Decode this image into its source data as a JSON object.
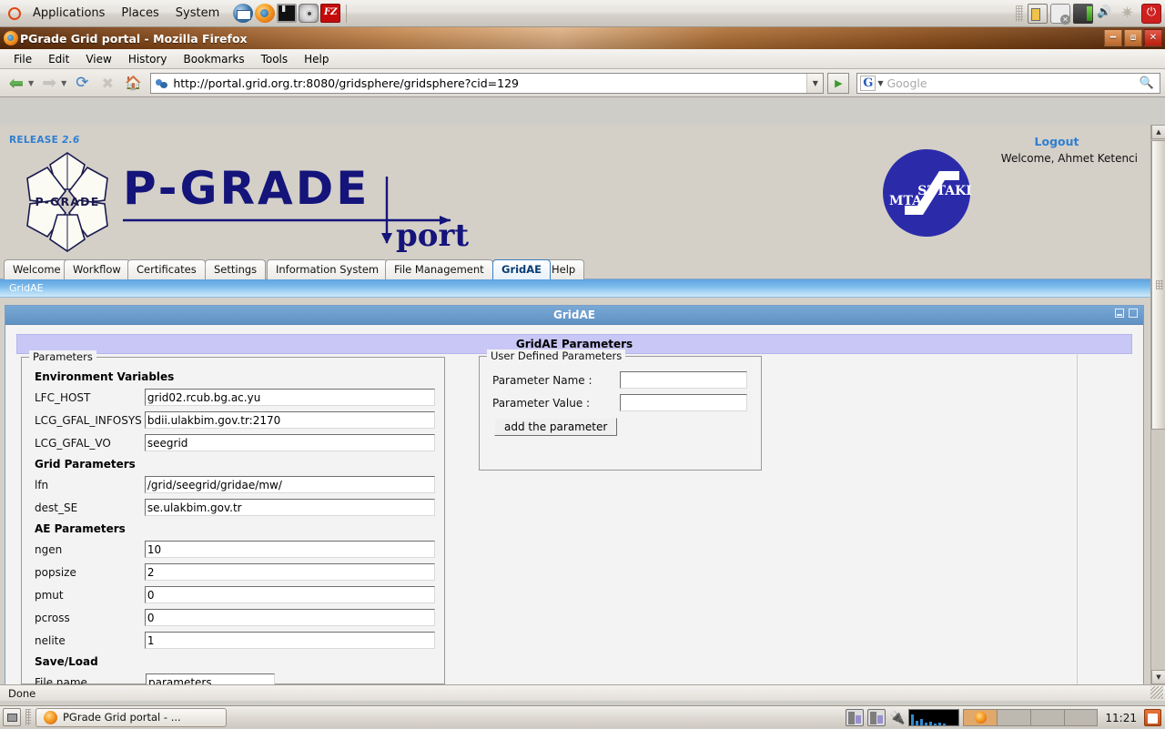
{
  "desktop": {
    "top_panel": {
      "menus": [
        "Applications",
        "Places",
        "System"
      ],
      "launchers": [
        "thunderbird-icon",
        "firefox-icon",
        "terminal-icon",
        "disc-burner-icon",
        "filezilla-icon"
      ],
      "tray": [
        "battery-icon",
        "message-icon",
        "network-icon",
        "volume-icon",
        "gear-icon",
        "power-icon"
      ]
    },
    "bottom_panel": {
      "show_desktop_label": "show-desktop-icon",
      "task_button": "PGrade Grid portal - ...",
      "clock": "11:21",
      "applets": [
        "cpu-monitor-icon",
        "cpu-monitor-icon",
        "power-plug-icon",
        "network-graph-icon"
      ],
      "workspaces": 4,
      "active_workspace": 1,
      "trash_label": "trash-icon"
    }
  },
  "browser": {
    "window_title": "PGrade Grid portal - Mozilla Firefox",
    "window_buttons": [
      "minimize",
      "restore",
      "close"
    ],
    "menubar": [
      "File",
      "Edit",
      "View",
      "History",
      "Bookmarks",
      "Tools",
      "Help"
    ],
    "toolbar": {
      "back": "back-arrow",
      "forward": "forward-arrow",
      "reload": "reload-icon",
      "stop": "stop-icon",
      "home": "home-icon",
      "go": "go-icon"
    },
    "url": "http://portal.grid.org.tr:8080/gridsphere/gridsphere?cid=129",
    "search": {
      "engine": "G",
      "placeholder": "Google",
      "value": ""
    },
    "status": "Done"
  },
  "portal": {
    "release": "RELEASE 2.6",
    "release_label": "RELEASE",
    "release_version": "2.6",
    "logo_text": "P-GRADE",
    "logo_sub": "portal",
    "logo_hex_text": "P-GRADE",
    "institute_logo": [
      "MTA",
      "SZTAKI"
    ],
    "logout": "Logout",
    "welcome": "Welcome, Ahmet Ketenci",
    "tabs": [
      {
        "label": "Welcome",
        "active": false
      },
      {
        "label": "Workflow",
        "active": false
      },
      {
        "label": "Certificates",
        "active": false
      },
      {
        "label": "Settings",
        "active": false
      },
      {
        "label": "Information System",
        "active": false
      },
      {
        "label": "File Management",
        "active": false
      },
      {
        "label": "GridAE",
        "active": true
      },
      {
        "label": "Help",
        "active": false
      }
    ],
    "subtab": "GridAE",
    "portlet": {
      "title": "GridAE",
      "banner": "GridAE Parameters",
      "window_controls": [
        "minimize-icon",
        "maximize-icon"
      ]
    },
    "parameters_fieldset": {
      "legend": "Parameters",
      "sections": [
        {
          "heading": "Environment Variables",
          "fields": [
            {
              "label": "LFC_HOST",
              "value": "grid02.rcub.bg.ac.yu"
            },
            {
              "label": "LCG_GFAL_INFOSYS",
              "value": "bdii.ulakbim.gov.tr:2170"
            },
            {
              "label": "LCG_GFAL_VO",
              "value": "seegrid"
            }
          ]
        },
        {
          "heading": "Grid Parameters",
          "fields": [
            {
              "label": "lfn",
              "value": "/grid/seegrid/gridae/mw/"
            },
            {
              "label": "dest_SE",
              "value": "se.ulakbim.gov.tr"
            }
          ]
        },
        {
          "heading": "AE Parameters",
          "fields": [
            {
              "label": "ngen",
              "value": "10"
            },
            {
              "label": "popsize",
              "value": "2"
            },
            {
              "label": "pmut",
              "value": "0"
            },
            {
              "label": "pcross",
              "value": "0"
            },
            {
              "label": "nelite",
              "value": "1"
            }
          ]
        },
        {
          "heading": "Save/Load",
          "fields": [
            {
              "label": "File name",
              "value": "parameters"
            }
          ]
        }
      ]
    },
    "user_defined_fieldset": {
      "legend": "User Defined Parameters",
      "name_label": "Parameter Name :",
      "name_value": "",
      "value_label": "Parameter Value :",
      "value_value": "",
      "add_button": "add the parameter"
    }
  }
}
